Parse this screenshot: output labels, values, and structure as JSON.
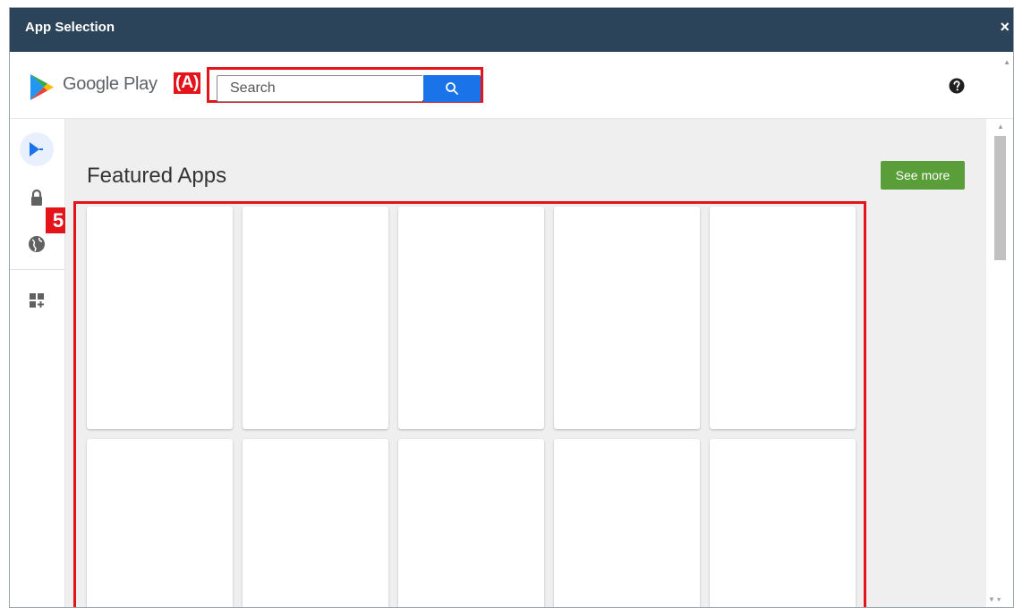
{
  "window": {
    "title": "App Selection",
    "close_symbol": "×"
  },
  "header": {
    "brand": "Google Play",
    "search_placeholder": "Search",
    "annotation_a": "(A)"
  },
  "sidebar": {
    "annotation_number": "5",
    "items": [
      {
        "id": "play",
        "icon": "play-store-icon",
        "active": true
      },
      {
        "id": "private",
        "icon": "lock-icon",
        "active": false
      },
      {
        "id": "web",
        "icon": "globe-icon",
        "active": false
      },
      {
        "id": "layout",
        "icon": "widgets-add-icon",
        "active": false
      }
    ]
  },
  "main": {
    "heading": "Featured Apps",
    "see_more_label": "See more",
    "cards": [
      {},
      {},
      {},
      {},
      {},
      {},
      {},
      {},
      {},
      {}
    ]
  },
  "colors": {
    "titlebar": "#2c4459",
    "accent_blue": "#1a73e8",
    "see_more_green": "#5a9e3a",
    "annotation_red": "#e4141b",
    "content_bg": "#efefef"
  }
}
